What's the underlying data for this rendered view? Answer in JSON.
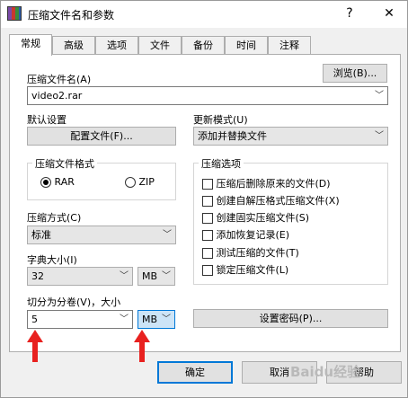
{
  "window": {
    "title": "压缩文件名和参数",
    "help_label": "?",
    "close_label": "✕"
  },
  "tabs": [
    "常规",
    "高级",
    "选项",
    "文件",
    "备份",
    "时间",
    "注释"
  ],
  "archive_name": {
    "label": "压缩文件名(A)",
    "browse_label": "浏览(B)...",
    "value": "video2.rar"
  },
  "default_settings": {
    "label": "默认设置",
    "profiles_label": "配置文件(F)..."
  },
  "update_mode": {
    "label": "更新模式(U)",
    "value": "添加并替换文件"
  },
  "archive_format": {
    "label": "压缩文件格式",
    "options": [
      "RAR",
      "ZIP"
    ],
    "selected": "RAR"
  },
  "compression_method": {
    "label": "压缩方式(C)",
    "value": "标准"
  },
  "dictionary_size": {
    "label": "字典大小(I)",
    "value": "32",
    "unit": "MB"
  },
  "split_volumes": {
    "label": "切分为分卷(V)，大小",
    "value": "5",
    "unit": "MB"
  },
  "archiving_options": {
    "label": "压缩选项",
    "items": [
      "压缩后删除原来的文件(D)",
      "创建自解压格式压缩文件(X)",
      "创建固实压缩文件(S)",
      "添加恢复记录(E)",
      "测试压缩的文件(T)",
      "锁定压缩文件(L)"
    ]
  },
  "set_password_label": "设置密码(P)...",
  "footer": {
    "ok_label": "确定",
    "cancel_label": "取消",
    "help_label": "帮助"
  },
  "watermark": "Baidu经验",
  "colors": {
    "arrow": "#e8211f",
    "focus_border": "#0078d7",
    "selection": "#cce4f7"
  }
}
